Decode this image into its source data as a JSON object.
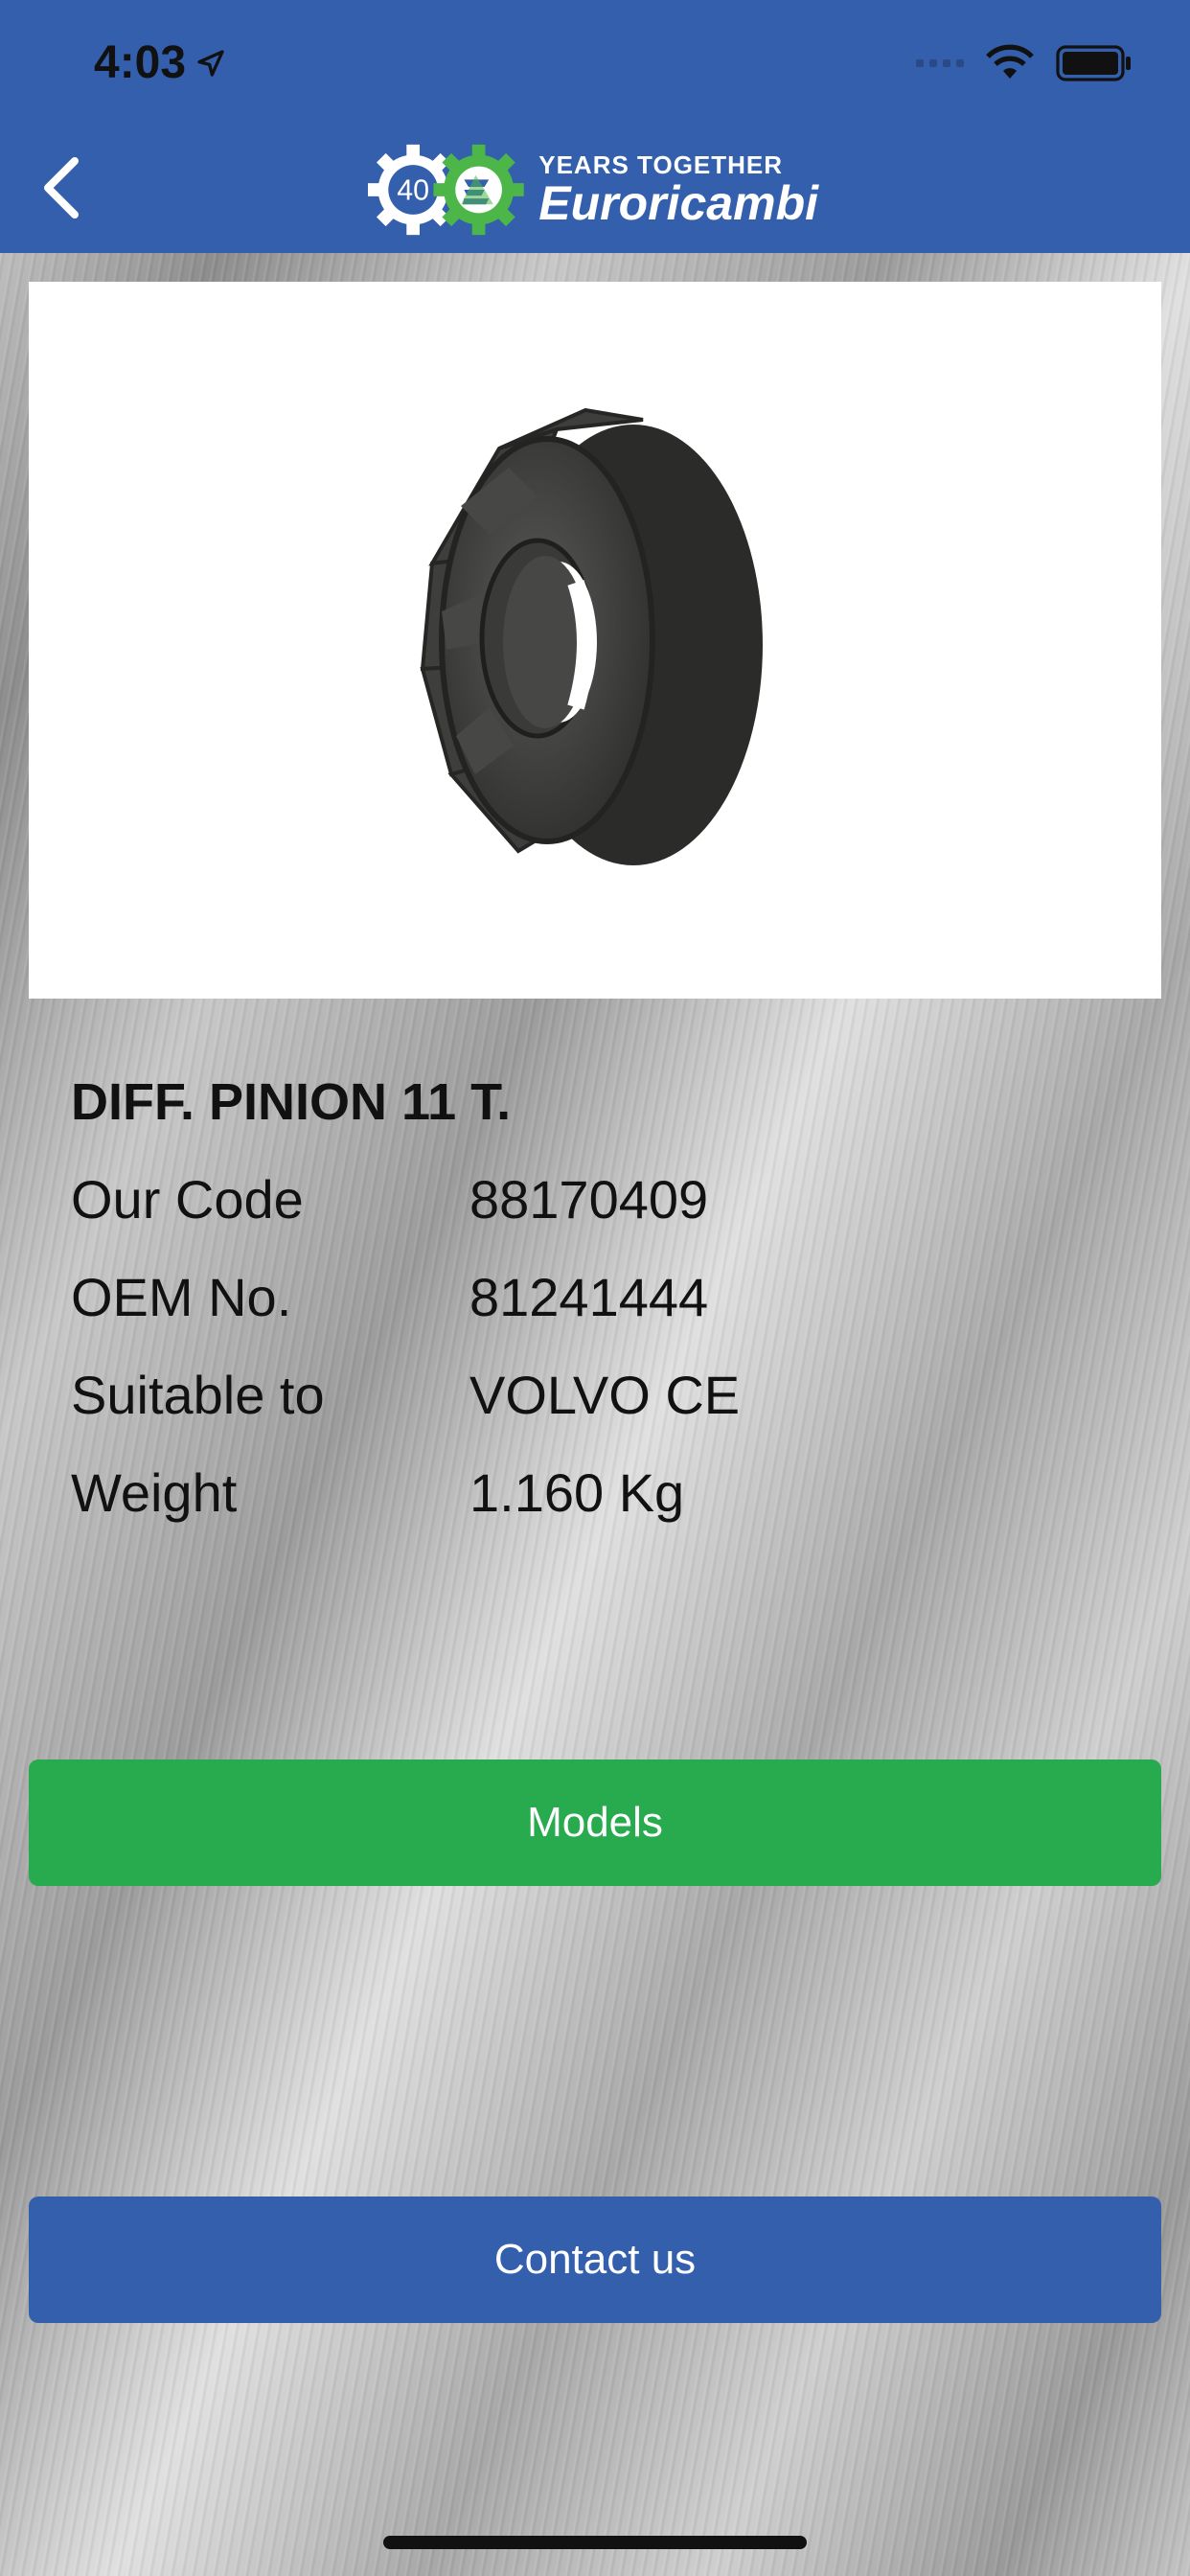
{
  "status_bar": {
    "time": "4:03",
    "location_icon": "location-arrow-icon",
    "wifi_icon": "wifi-icon",
    "battery_icon": "battery-icon"
  },
  "nav": {
    "back_icon": "chevron-left-icon",
    "logo": {
      "number": "40",
      "tagline": "YEARS TOGETHER",
      "brand": "Euroricambi"
    }
  },
  "product": {
    "image_icon": "gear-pinion-image",
    "title": "DIFF. PINION 11 T.",
    "specs": [
      {
        "label": "Our Code",
        "value": "88170409"
      },
      {
        "label": "OEM No.",
        "value": "81241444"
      },
      {
        "label": "Suitable to",
        "value": "VOLVO CE"
      },
      {
        "label": "Weight",
        "value": "1.160 Kg"
      }
    ]
  },
  "actions": {
    "models_label": "Models",
    "contact_label": "Contact us"
  },
  "colors": {
    "header_blue": "#335fad",
    "models_green": "#27ab4e",
    "contact_blue": "#335fad"
  }
}
